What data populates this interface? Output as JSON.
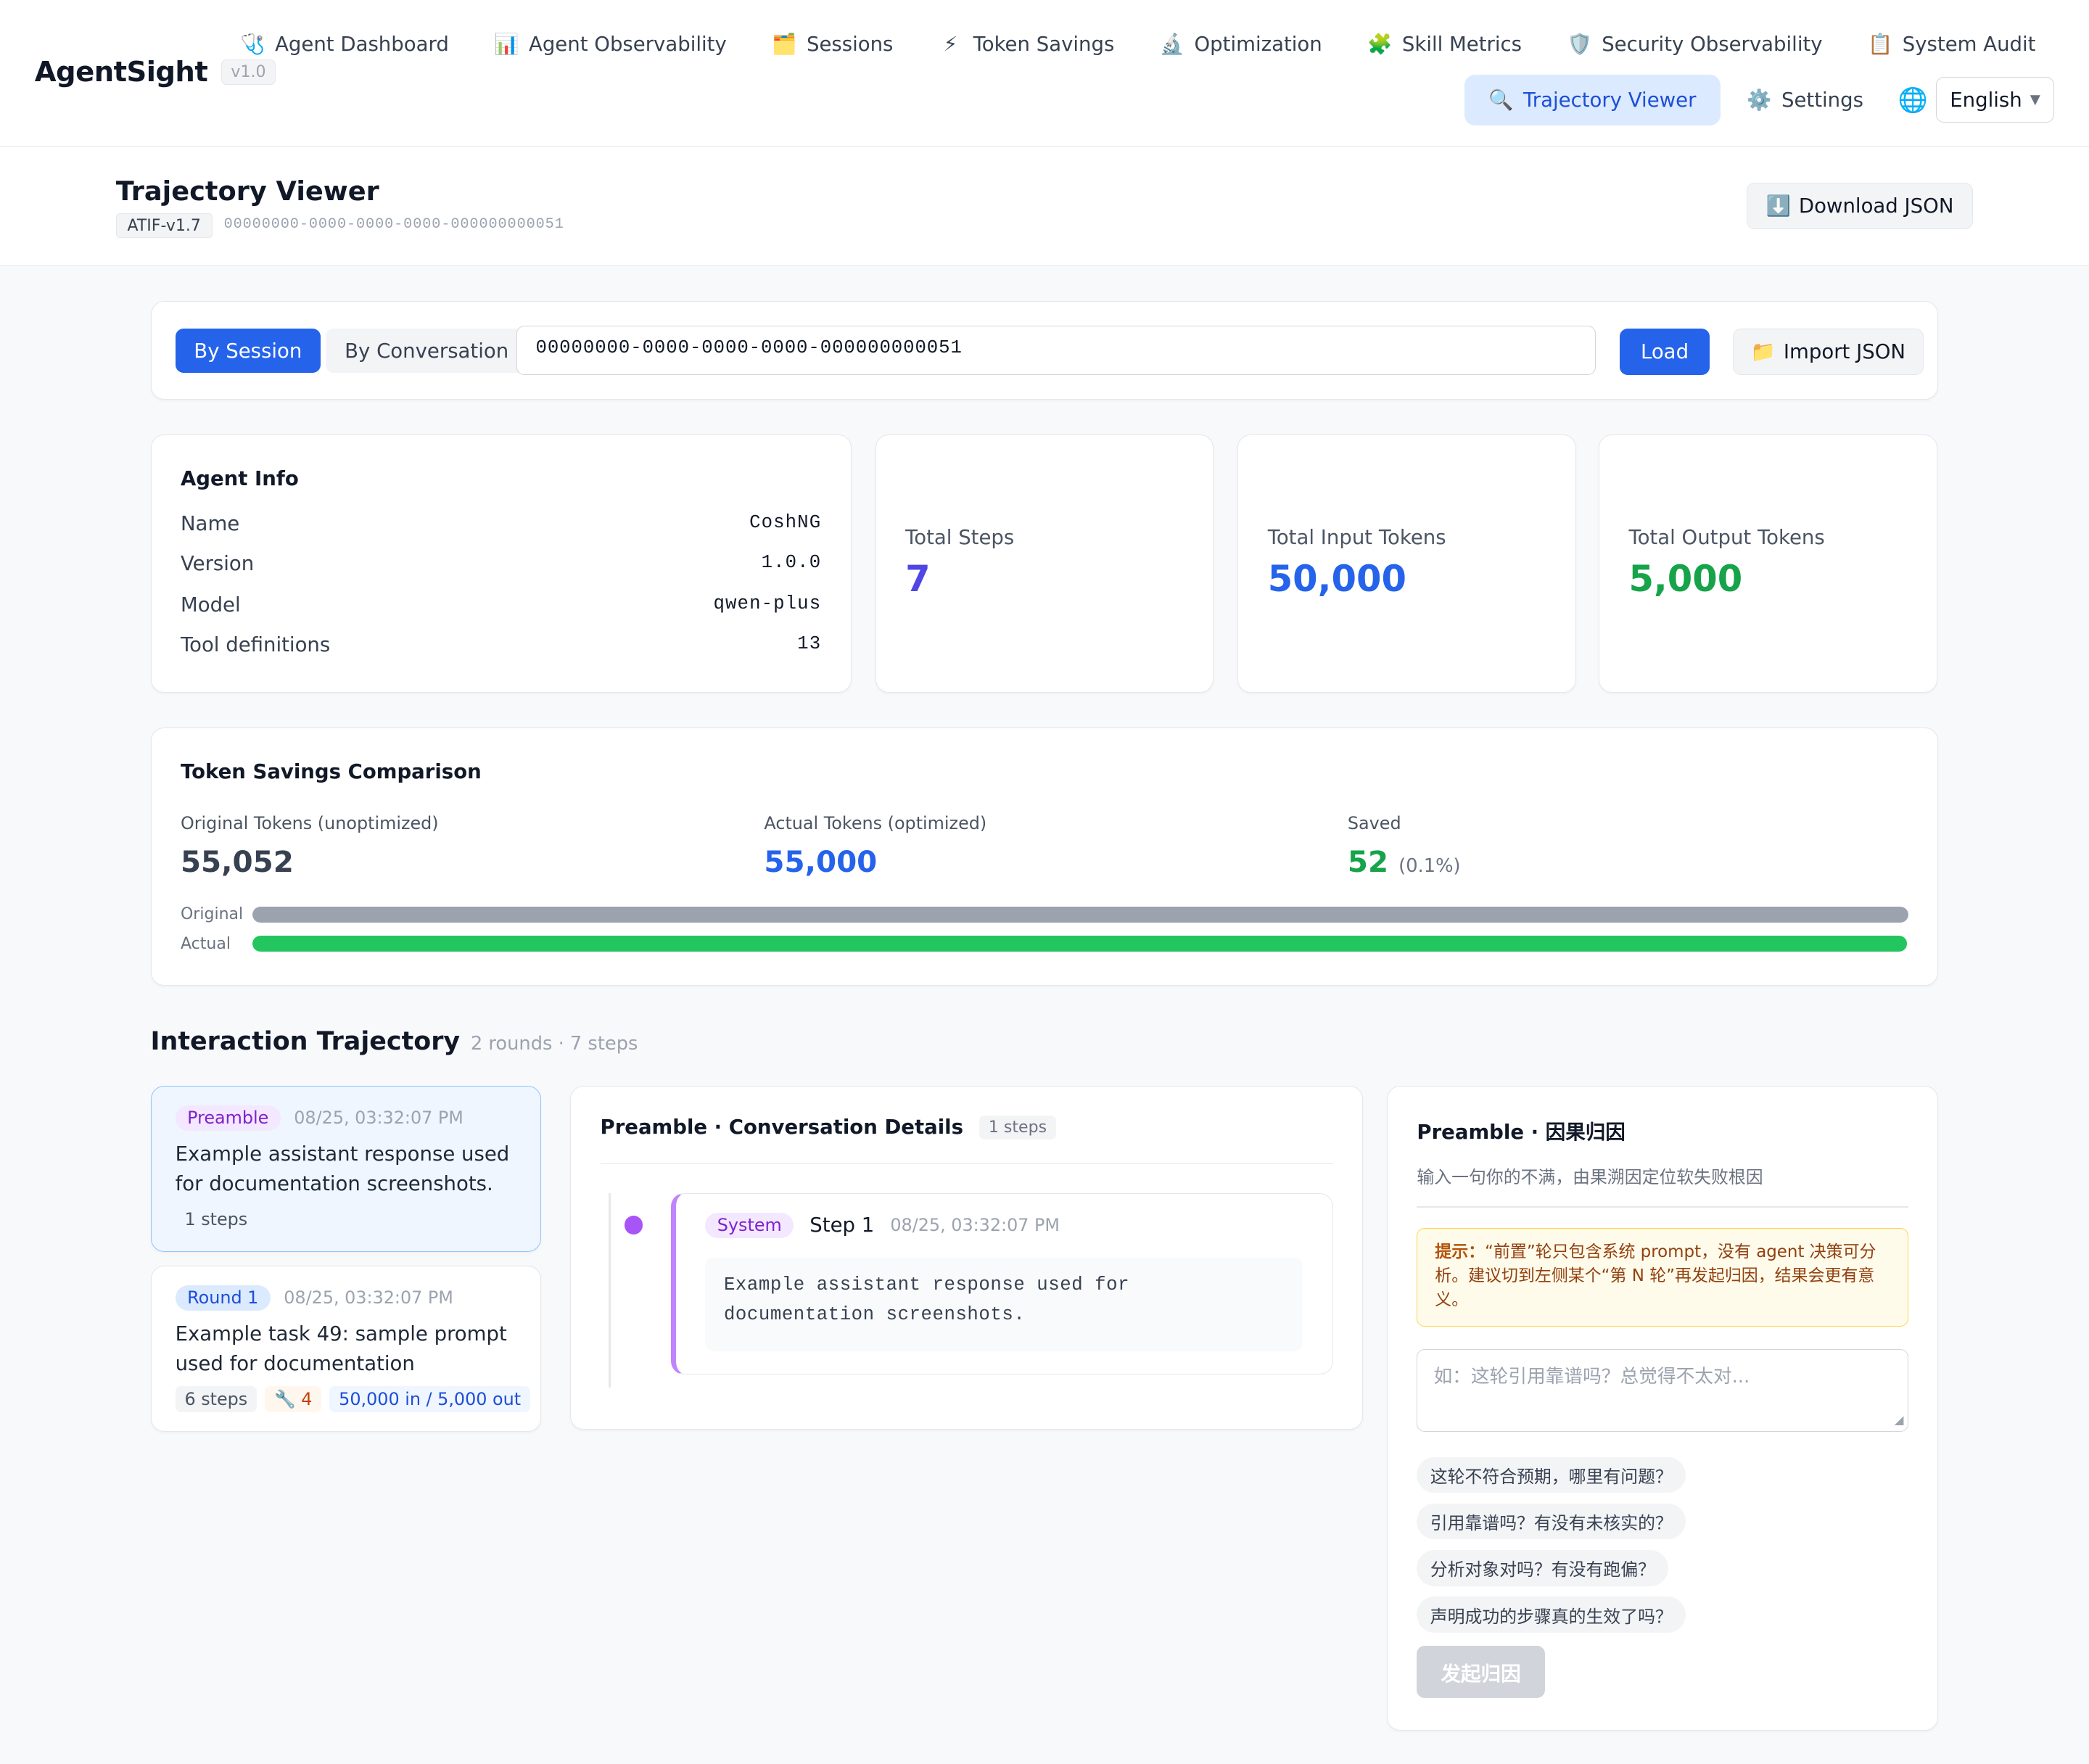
{
  "brand": {
    "name": "AgentSight",
    "version": "v1.0"
  },
  "nav": {
    "row1": [
      {
        "icon": "🩺",
        "label": "Agent Dashboard"
      },
      {
        "icon": "📊",
        "label": "Agent Observability"
      },
      {
        "icon": "🗂️",
        "label": "Sessions"
      },
      {
        "icon": "⚡",
        "label": "Token Savings"
      },
      {
        "icon": "🔬",
        "label": "Optimization"
      },
      {
        "icon": "🧩",
        "label": "Skill Metrics"
      },
      {
        "icon": "🛡️",
        "label": "Security Observability"
      },
      {
        "icon": "📋",
        "label": "System Audit"
      }
    ],
    "row2": [
      {
        "icon": "🔍",
        "label": "Trajectory Viewer",
        "active": true
      },
      {
        "icon": "⚙️",
        "label": "Settings"
      }
    ],
    "language": "English"
  },
  "page": {
    "title": "Trajectory Viewer",
    "schema": "ATIF-v1.7",
    "trajectory_id": "00000000-0000-0000-0000-000000000051",
    "download_label": "Download JSON"
  },
  "search": {
    "tab_session": "By Session",
    "tab_conversation": "By Conversation",
    "value": "00000000-0000-0000-0000-000000000051",
    "load_label": "Load",
    "import_label": "Import JSON"
  },
  "agent": {
    "heading": "Agent Info",
    "rows": [
      {
        "key": "Name",
        "value": "CoshNG"
      },
      {
        "key": "Version",
        "value": "1.0.0"
      },
      {
        "key": "Model",
        "value": "qwen-plus"
      },
      {
        "key": "Tool definitions",
        "value": "13"
      }
    ]
  },
  "stats": [
    {
      "label": "Total Steps",
      "value": "7",
      "color": "#4f46e5"
    },
    {
      "label": "Total Input Tokens",
      "value": "50,000",
      "color": "#2563eb"
    },
    {
      "label": "Total Output Tokens",
      "value": "5,000",
      "color": "#16a34a"
    }
  ],
  "savings": {
    "heading": "Token Savings Comparison",
    "original_label": "Original Tokens (unoptimized)",
    "original_value": "55,052",
    "actual_label": "Actual Tokens (optimized)",
    "actual_value": "55,000",
    "saved_label": "Saved",
    "saved_value": "52",
    "saved_pct": "(0.1%)",
    "bar_original_label": "Original",
    "bar_actual_label": "Actual",
    "bar_original_fraction": 1.0,
    "bar_actual_fraction": 0.999
  },
  "trajectory": {
    "title": "Interaction Trajectory",
    "summary": "2 rounds · 7 steps",
    "rounds": [
      {
        "tag": "Preamble",
        "time": "08/25, 03:32:07 PM",
        "text": "Example assistant response used for documentation screenshots.",
        "steps": "1 steps"
      },
      {
        "tag": "Round 1",
        "time": "08/25, 03:32:07 PM",
        "text": "Example task 49: sample prompt used for documentation",
        "steps": "6 steps",
        "tools": "🔧 4",
        "tokens": "50,000 in / 5,000 out"
      }
    ]
  },
  "detail": {
    "title": "Preamble · Conversation Details",
    "count": "1 steps",
    "step": {
      "role": "System",
      "name": "Step 1",
      "time": "08/25, 03:32:07 PM",
      "body": "Example assistant response used for documentation screenshots."
    }
  },
  "causal": {
    "title": "Preamble · 因果归因",
    "subtitle": "输入一句你的不满，由果溯因定位软失败根因",
    "hint_label": "提示：",
    "hint_text": "“前置”轮只包含系统 prompt，没有 agent 决策可分析。建议切到左侧某个“第 N 轮”再发起归因，结果会更有意义。",
    "placeholder": "如：这轮引用靠谱吗？总觉得不太对...",
    "suggestions": [
      "这轮不符合预期，哪里有问题？",
      "引用靠谱吗？有没有未核实的？",
      "分析对象对吗？有没有跑偏？",
      "声明成功的步骤真的生效了吗？"
    ],
    "submit_label": "发起归因"
  }
}
